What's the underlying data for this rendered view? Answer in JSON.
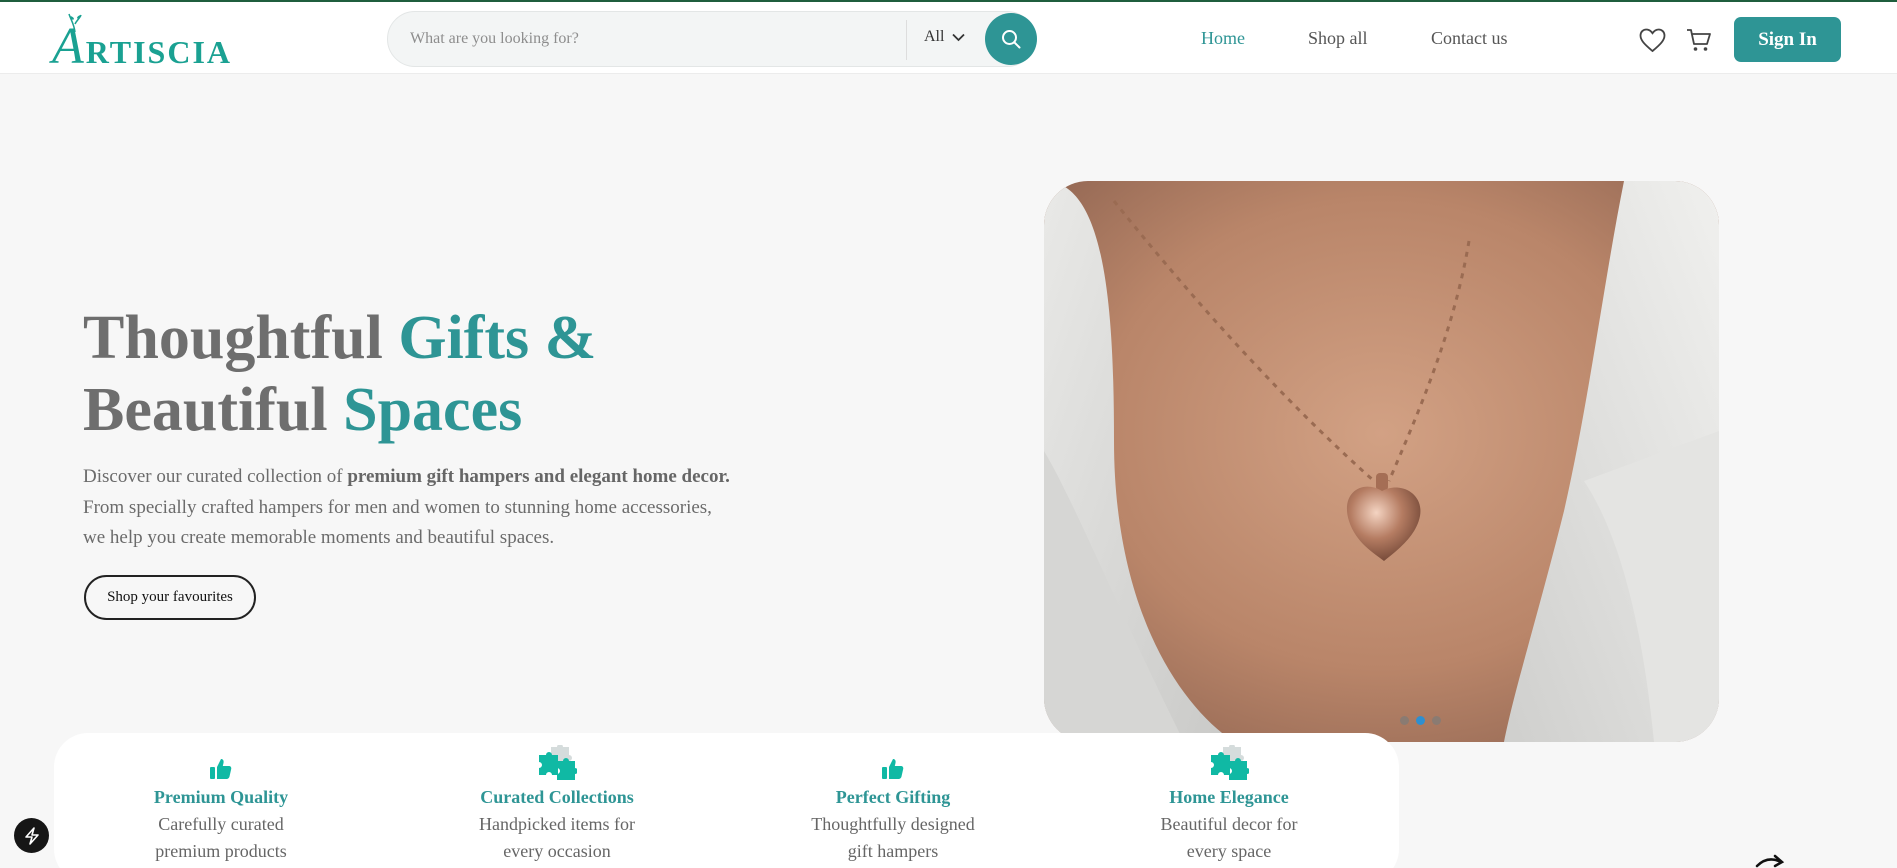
{
  "brand": {
    "logo_text": "ARTISCIA",
    "accent_color": "#2e9595",
    "logo_color": "#1aa192"
  },
  "search": {
    "placeholder": "What are you looking for?",
    "category": "All"
  },
  "nav": {
    "items": [
      {
        "label": "Home",
        "active": true
      },
      {
        "label": "Shop all",
        "active": false
      },
      {
        "label": "Contact us",
        "active": false
      }
    ]
  },
  "actions": {
    "wishlist_icon": "heart-icon",
    "cart_icon": "cart-icon",
    "signin_label": "Sign In"
  },
  "hero": {
    "title_line1_plain": "Thoughtful ",
    "title_line1_accent": "Gifts &",
    "title_line2_plain": "Beautiful ",
    "title_line2_accent": "Spaces",
    "desc_lead": "Discover our curated collection of ",
    "desc_bold": "premium gift hampers and elegant home decor.",
    "desc_line2": "From specially crafted hampers for men and women to stunning home accessories,",
    "desc_line3": "we help you create memorable moments and beautiful spaces.",
    "cta_label": "Shop your favourites",
    "carousel": {
      "slides": 3,
      "active_index": 1
    }
  },
  "features": [
    {
      "icon": "thumbs-up-icon",
      "title": "Premium Quality",
      "sub1": "Carefully curated",
      "sub2": "premium products"
    },
    {
      "icon": "puzzle-icon",
      "title": "Curated Collections",
      "sub1": "Handpicked items for",
      "sub2": "every occasion"
    },
    {
      "icon": "thumbs-up-icon",
      "title": "Perfect Gifting",
      "sub1": "Thoughtfully designed",
      "sub2": "gift hampers"
    },
    {
      "icon": "puzzle-icon",
      "title": "Home Elegance",
      "sub1": "Beautiful decor for",
      "sub2": "every space"
    }
  ]
}
